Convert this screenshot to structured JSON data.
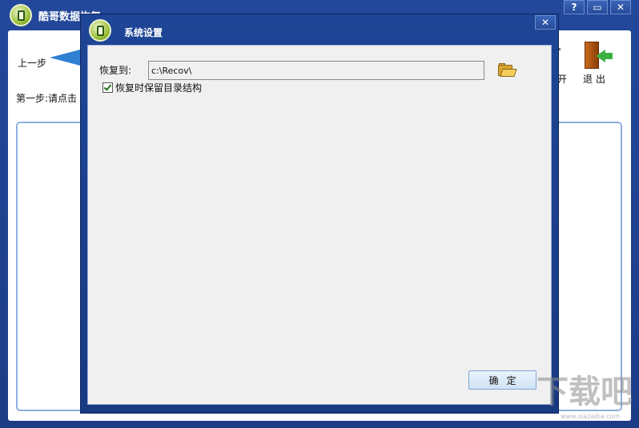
{
  "main_window": {
    "title": "酷哥数据恢复",
    "help_label": "?",
    "minimize_label": "▭",
    "close_label": "✕",
    "prev_label": "上一步",
    "step_text": "第一步:请点击",
    "partial_toolbar_label": "开",
    "exit_label": "退出"
  },
  "dialog": {
    "title": "系统设置",
    "close_label": "✕",
    "restore_to_label": "恢复到:",
    "restore_path_value": "c:\\Recov\\",
    "keep_structure_label": "恢复时保留目录结构",
    "keep_structure_checked": true,
    "ok_label": "确定"
  },
  "watermark": {
    "text": "下载吧",
    "url": "www.xiazaiba.com"
  },
  "icons": {
    "app_logo": "app-logo-icon",
    "folder": "folder-open-icon",
    "exit": "exit-door-icon",
    "prev": "back-arrow-icon"
  },
  "colors": {
    "titlebar": "#1f4596",
    "dialog_body": "#f0f0f0",
    "accent_arrow": "#2f7fd3",
    "exit_arrow": "#3cb043"
  }
}
